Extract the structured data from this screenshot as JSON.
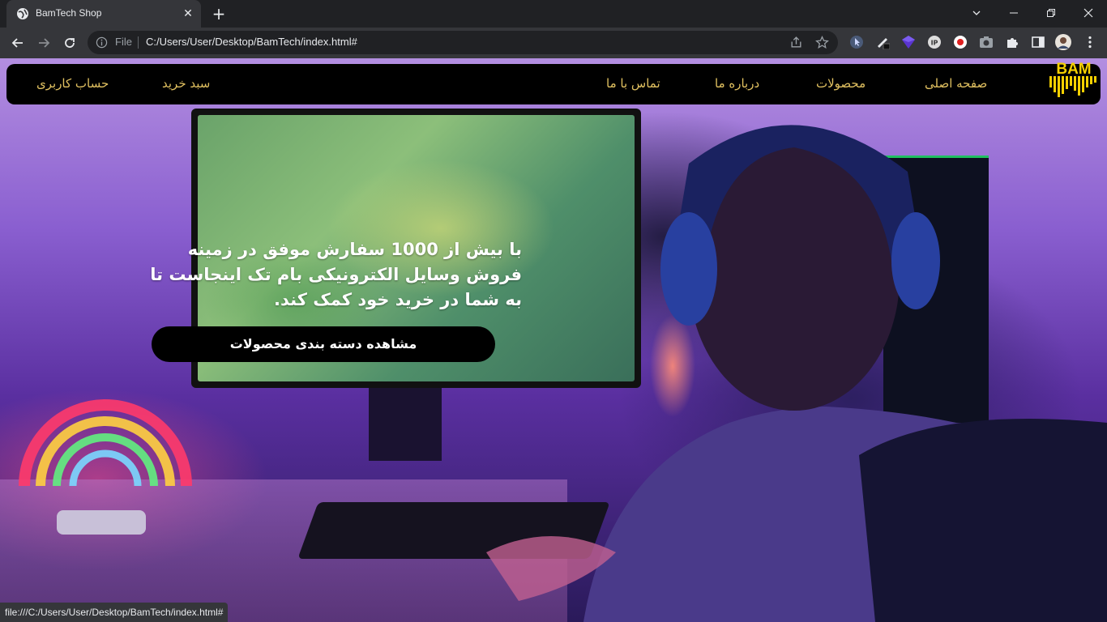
{
  "browser": {
    "tab_title": "BamTech Shop",
    "omnibox_scheme": "File",
    "url": "C:/Users/User/Desktop/BamTech/index.html#",
    "status_url": "file:///C:/Users/User/Desktop/BamTech/index.html#"
  },
  "nav": {
    "items": [
      {
        "label": "صفحه اصلی"
      },
      {
        "label": "محصولات"
      },
      {
        "label": "درباره ما"
      },
      {
        "label": "تماس با ما"
      },
      {
        "label": "سبد خرید"
      },
      {
        "label": "حساب کاربری"
      }
    ],
    "logo_text": "BAM",
    "link_color": "#e0c060"
  },
  "hero": {
    "text": "با بیش از 1000 سفارش موفق در زمینه فروش وسایل الکترونیکی بام تک اینجاست تا به شما در خرید خود کمک کند.",
    "button_label": "مشاهده دسته بندی محصولات"
  },
  "colors": {
    "accent": "#e0c060",
    "logo_yellow": "#f5d000"
  }
}
